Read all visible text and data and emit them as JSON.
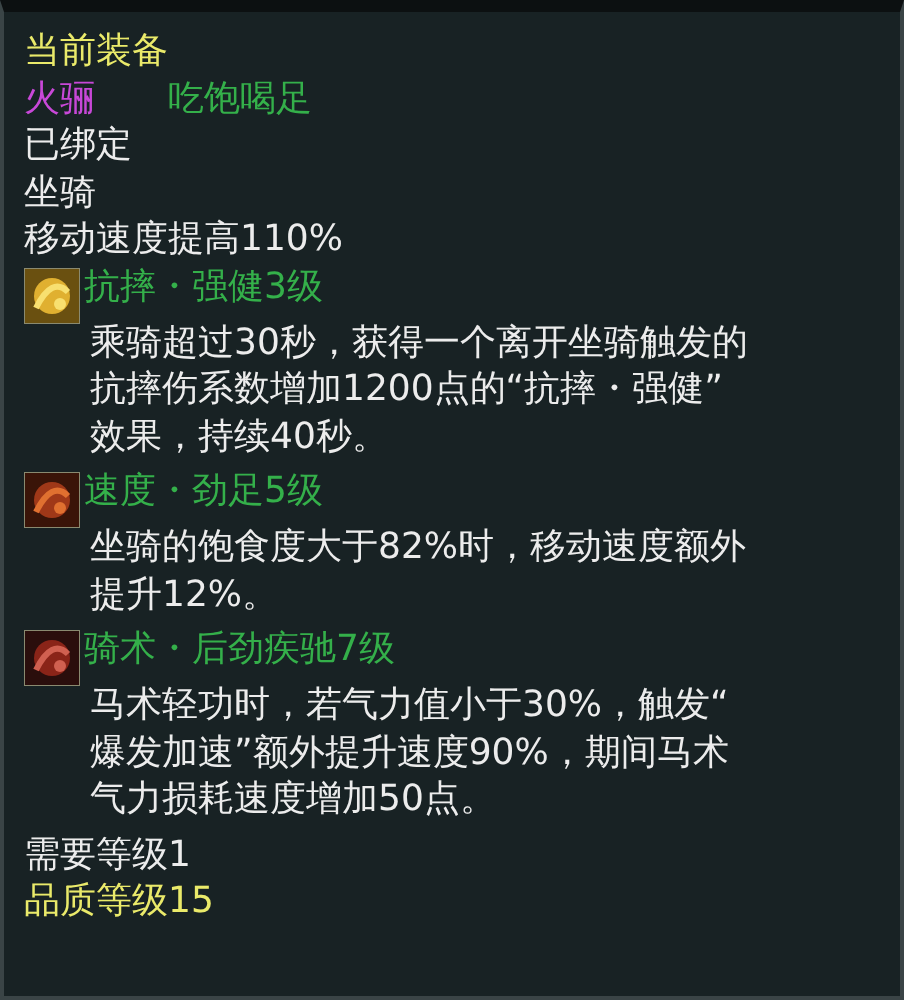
{
  "header": "当前装备",
  "item": {
    "name": "火骊",
    "trait": "吃饱喝足"
  },
  "bound": "已绑定",
  "type": "坐骑",
  "stat": "移动速度提高110%",
  "skills": [
    {
      "title": "抗摔・强健3级",
      "lines": [
        "乘骑超过30秒，获得一个离开坐骑触发的",
        "抗摔伤系数增加1200点的“抗摔・强健”",
        "效果，持续40秒。"
      ]
    },
    {
      "title": "速度・劲足5级",
      "lines": [
        "坐骑的饱食度大于82%时，移动速度额外",
        "提升12%。"
      ]
    },
    {
      "title": "骑术・后劲疾驰7级",
      "lines": [
        "马术轻功时，若气力值小于30%，触发“",
        "爆发加速”额外提升速度90%，期间马术",
        "气力损耗速度增加50点。"
      ]
    }
  ],
  "requirement": "需要等级1",
  "quality": "品质等级15"
}
